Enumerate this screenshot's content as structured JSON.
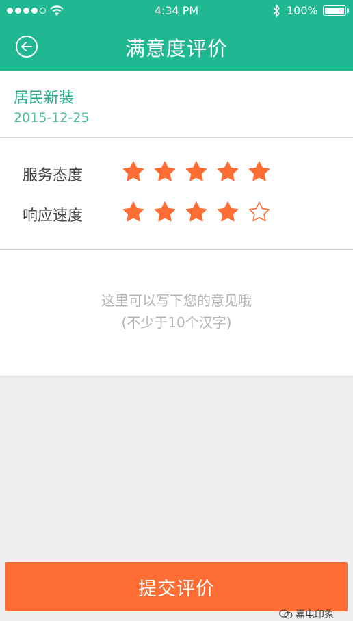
{
  "status_bar": {
    "time": "4:34 PM",
    "battery": "100%"
  },
  "header": {
    "title": "满意度评价"
  },
  "order": {
    "type": "居民新装",
    "date": "2015-12-25"
  },
  "ratings": [
    {
      "label": "服务态度",
      "score": 5,
      "max": 5
    },
    {
      "label": "响应速度",
      "score": 4,
      "max": 5
    }
  ],
  "comment": {
    "placeholder": "这里可以写下您的意见哦\n(不少于10个汉字)",
    "value": ""
  },
  "submit": {
    "label": "提交评价"
  },
  "watermark": {
    "text": "嘉电印象"
  },
  "colors": {
    "header": "#1fb893",
    "accent_text": "#27ab8a",
    "star": "#fe6d34",
    "submit": "#fe6d34"
  }
}
